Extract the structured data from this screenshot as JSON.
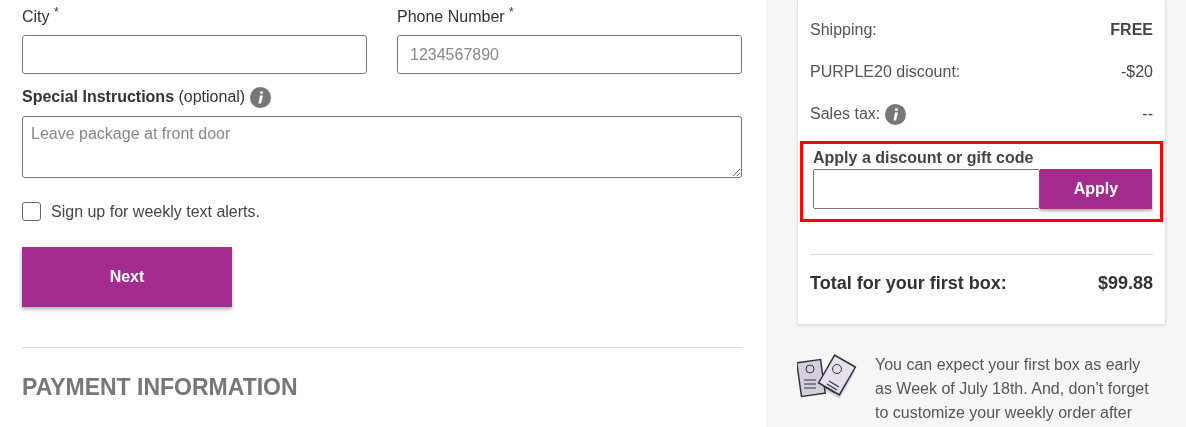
{
  "address_form": {
    "fields": [
      {
        "kind": "input",
        "label": "City $^{*}$"
      },
      {
        "kind": "input",
        "label": "Phone Number $^{*}$",
        "placeholder": "1234567890"
      },
      {
        "kind": "textarea",
        "label": "**Special Instructions** (optional)",
        "info": true,
        "placeholder": "Leave package at front door"
      }
    ],
    "text_alerts": {
      "label": "Sign up for weekly text alerts.",
      "checked": false
    },
    "next_button": "Next"
  },
  "payment_heading": "PAYMENT INFORMATION",
  "order_summary": {
    "lines": [
      {
        "label": "Shipping:",
        "value": "FREE",
        "bold_value": true,
        "info": false
      },
      {
        "label": "PURPLE20 discount:",
        "value": "-$20",
        "bold_value": false,
        "info": false
      },
      {
        "label": "Sales tax:",
        "value": "--",
        "bold_value": false,
        "info": true
      }
    ],
    "discount": {
      "label": "Apply a discount or gift code",
      "highlighted": true,
      "button": "Apply"
    },
    "total": {
      "label": "Total for your first box:",
      "value": "$99.88"
    }
  },
  "delivery_note": "You can expect your first box as early as Week of July 18th. And, don’t forget to customize your weekly order after"
}
